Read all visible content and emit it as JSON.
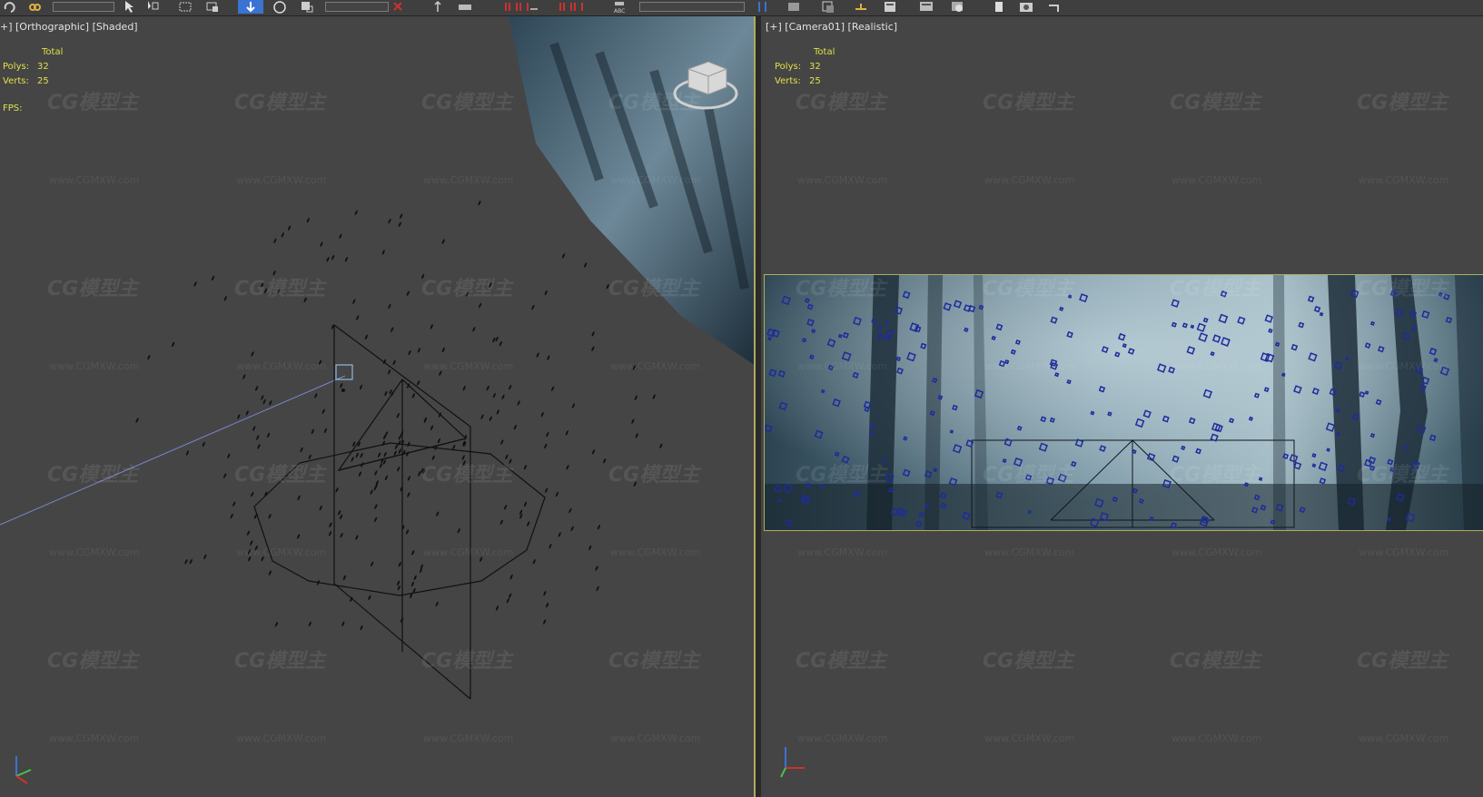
{
  "viewports": {
    "left": {
      "label": "+] [Orthographic] [Shaded]",
      "stats": {
        "header": "Total",
        "polys_label": "Polys:",
        "polys": "32",
        "verts_label": "Verts:",
        "verts": "25",
        "fps_label": "FPS:"
      }
    },
    "right": {
      "label": "[+] [Camera01] [Realistic]",
      "stats": {
        "header": "Total",
        "polys_label": "Polys:",
        "polys": "32",
        "verts_label": "Verts:",
        "verts": "25"
      }
    }
  },
  "watermark": {
    "logo": "CG模型主",
    "url": "www.CGMXW.com"
  },
  "colors": {
    "viewport_bg": "#454545",
    "stats_text": "#e1e049",
    "active_border": "#b0a860",
    "selection_blue": "#3b73d2"
  },
  "icons": [
    "undo-icon",
    "link-icon",
    "select-icon",
    "region-select-icon",
    "select-move-icon",
    "rotate-icon",
    "snap-icon",
    "mirror-icon",
    "align-icon",
    "render-icon"
  ]
}
